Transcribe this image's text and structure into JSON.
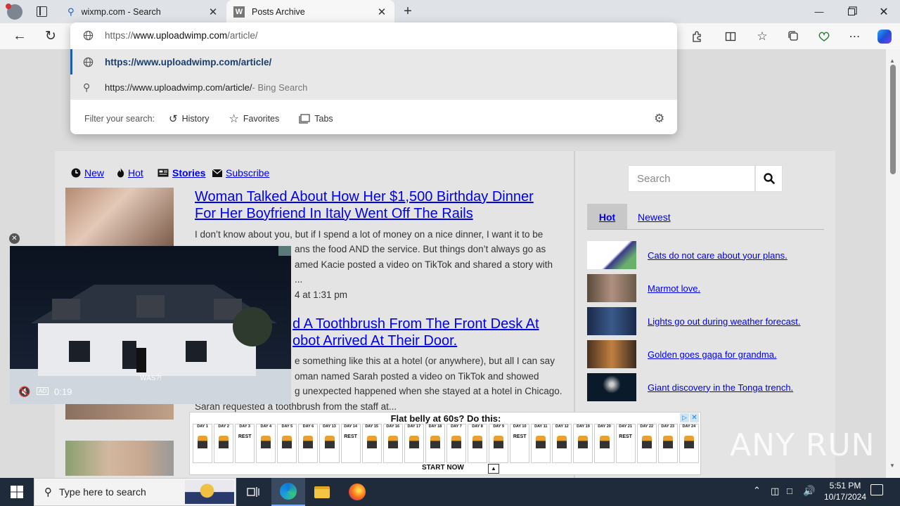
{
  "browser": {
    "tabs": [
      {
        "title": "wixmp.com - Search",
        "icon": "search-icon"
      },
      {
        "title": "Posts Archive",
        "icon": "w-logo-icon"
      }
    ],
    "address": {
      "prefix": "https://",
      "domain": "www.uploadwimp.com",
      "path": "/article/"
    },
    "suggestions": [
      {
        "text": "https://www.uploadwimp.com/article/",
        "icon": "globe-icon"
      },
      {
        "text": "https://www.uploadwimp.com/article/",
        "suffix": " - Bing Search",
        "icon": "search-icon"
      }
    ],
    "filter": {
      "label": "Filter your search:",
      "history": "History",
      "favorites": "Favorites",
      "tabs": "Tabs"
    }
  },
  "site": {
    "nav": {
      "new": "New",
      "hot": "Hot",
      "stories": "Stories",
      "subscribe": "Subscribe"
    },
    "articles": [
      {
        "title_line1": "Woman Talked About How Her $1,500 Birthday Dinner",
        "title_line2": "For Her Boyfriend In Italy Went Off The Rails",
        "excerpt": [
          "I don’t know about you, but if I spend a lot of money on a nice dinner, I want it to be",
          "ans the food AND the service. But things don’t always go as",
          "amed Kacie posted a video on TikTok and shared a story with",
          "..."
        ],
        "date": "4 at 1:31 pm"
      },
      {
        "title_line1": "d A Toothbrush From The Front Desk At",
        "title_line2": "obot Arrived At Their Door.",
        "excerpt": [
          "e something like this at a hotel (or anywhere), but all I can say",
          "oman named Sarah posted a video on TikTok and showed",
          "g unexpected happened when she stayed at a hotel in Chicago.",
          "Sarah requested a toothbrush from the staff at..."
        ]
      }
    ],
    "sidebar": {
      "search_placeholder": "Search",
      "tabs": {
        "hot": "Hot",
        "newest": "Newest"
      },
      "items": [
        {
          "text": "Cats do not care about your plans."
        },
        {
          "text": "Marmot love."
        },
        {
          "text": "Lights go out during weather forecast."
        },
        {
          "text": "Golden goes gaga for grandma."
        },
        {
          "text": "Giant discovery in the Tonga trench."
        }
      ]
    }
  },
  "video": {
    "time": "0:19",
    "caption": "WAS?!",
    "ad_badge": "AD"
  },
  "ad": {
    "headline": "Flat belly at 60s? Do this:",
    "cta": "START NOW",
    "days": [
      "DAY 1",
      "DAY 2",
      "DAY 3",
      "DAY 4",
      "DAY 5",
      "DAY 6",
      "DAY 13",
      "DAY 14",
      "DAY 15",
      "DAY 16",
      "DAY 17",
      "DAY 18",
      "DAY 7",
      "DAY 8",
      "DAY 9",
      "DAY 10",
      "DAY 11",
      "DAY 12",
      "DAY 19",
      "DAY 20",
      "DAY 21",
      "DAY 22",
      "DAY 23",
      "DAY 24"
    ],
    "rest_days": [
      "DAY 3",
      "DAY 14",
      "DAY 10",
      "DAY 21"
    ],
    "rest_label": "REST"
  },
  "taskbar": {
    "search_placeholder": "Type here to search",
    "time": "5:51 PM",
    "date": "10/17/2024"
  },
  "watermark": "ANY RUN"
}
